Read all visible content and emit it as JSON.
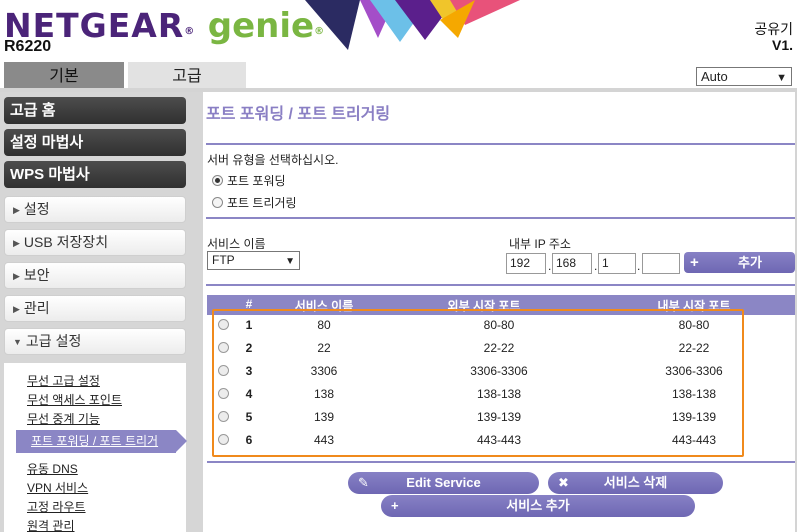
{
  "header": {
    "brand": "NETGEAR",
    "brand_reg": "®",
    "product": "genie",
    "product_tm": "®",
    "model": "R6220",
    "right_label": "공유기",
    "right_version": "V1."
  },
  "tabs": {
    "basic": "기본",
    "advanced": "고급"
  },
  "language": {
    "selected": "Auto"
  },
  "sidebar": {
    "advanced_home": "고급 홈",
    "setup_wizard": "설정 마법사",
    "wps_wizard": "WPS 마법사",
    "setup": "설정",
    "usb_storage": "USB 저장장치",
    "security": "보안",
    "administration": "관리",
    "advanced_setup": "고급 설정",
    "sub_items": [
      "무선 고급 설정",
      "무선 액세스 포인트",
      "무선 중계 기능",
      "포트 포워딩 / 포트 트리거",
      "유동 DNS",
      "VPN 서비스",
      "고정 라우트",
      "원격 관리"
    ]
  },
  "main": {
    "title": "포트 포워딩 / 포트 트리거링",
    "server_type_prompt": "서버 유형을 선택하십시오.",
    "radio_forwarding": "포트 포워딩",
    "radio_triggering": "포트 트리거링",
    "service_name_label": "서비스 이름",
    "service_name_value": "FTP",
    "internal_ip_label": "내부 IP 주소",
    "ip_octets": [
      "192",
      "168",
      "1",
      ""
    ],
    "add_button": "추가",
    "columns": [
      "#",
      "서비스 이름",
      "외부 시작 포트",
      "내부 시작 포트"
    ],
    "rows": [
      {
        "num": "1",
        "service": "80",
        "external": "80-80",
        "internal": "80-80"
      },
      {
        "num": "2",
        "service": "22",
        "external": "22-22",
        "internal": "22-22"
      },
      {
        "num": "3",
        "service": "3306",
        "external": "3306-3306",
        "internal": "3306-3306"
      },
      {
        "num": "4",
        "service": "138",
        "external": "138-138",
        "internal": "138-138"
      },
      {
        "num": "5",
        "service": "139",
        "external": "139-139",
        "internal": "139-139"
      },
      {
        "num": "6",
        "service": "443",
        "external": "443-443",
        "internal": "443-443"
      }
    ],
    "edit_button": "Edit Service",
    "delete_button": "서비스 삭제",
    "add_service_button": "서비스 추가"
  },
  "colors": {
    "brand_purple": "#4b2479",
    "genie_green": "#7ab642",
    "accent_purple": "#8b86c5",
    "highlight_orange": "#f08a1c"
  }
}
